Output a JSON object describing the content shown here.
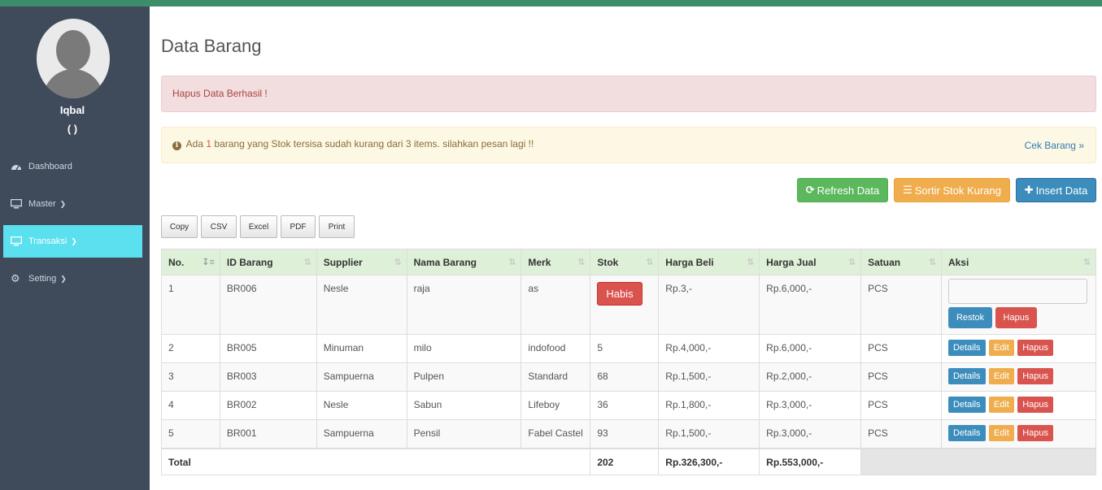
{
  "sidebar": {
    "user_name": "Iqbal",
    "user_role": "( )",
    "items": [
      {
        "label": "Dashboard",
        "icon": "dashboard-icon",
        "has_caret": false
      },
      {
        "label": "Master",
        "icon": "desktop-icon",
        "has_caret": true
      },
      {
        "label": "Transaksi",
        "icon": "desktop-icon",
        "has_caret": true,
        "active": true
      },
      {
        "label": "Setting",
        "icon": "gear-icon",
        "has_caret": true
      }
    ]
  },
  "page": {
    "title": "Data Barang",
    "alert_success": "Hapus Data Berhasil !",
    "alert_warning": {
      "prefix": "Ada",
      "count": "1",
      "suffix": "barang yang Stok tersisa sudah kurang dari 3 items. silahkan pesan lagi !!",
      "link": "Cek Barang »"
    }
  },
  "toolbar": {
    "refresh": "Refresh Data",
    "sort_low": "Sortir Stok Kurang",
    "insert": "Insert Data"
  },
  "export_buttons": [
    "Copy",
    "CSV",
    "Excel",
    "PDF",
    "Print"
  ],
  "table": {
    "headers": [
      "No.",
      "ID Barang",
      "Supplier",
      "Nama Barang",
      "Merk",
      "Stok",
      "Harga Beli",
      "Harga Jual",
      "Satuan",
      "Aksi"
    ],
    "rows": [
      {
        "no": "1",
        "id": "BR006",
        "supplier": "Nesle",
        "nama": "raja",
        "merk": "as",
        "stok": "Habis",
        "beli": "Rp.3,-",
        "jual": "Rp.6,000,-",
        "satuan": "PCS"
      },
      {
        "no": "2",
        "id": "BR005",
        "supplier": "Minuman",
        "nama": "milo",
        "merk": "indofood",
        "stok": "5",
        "beli": "Rp.4,000,-",
        "jual": "Rp.6,000,-",
        "satuan": "PCS"
      },
      {
        "no": "3",
        "id": "BR003",
        "supplier": "Sampuerna",
        "nama": "Pulpen",
        "merk": "Standard",
        "stok": "68",
        "beli": "Rp.1,500,-",
        "jual": "Rp.2,000,-",
        "satuan": "PCS"
      },
      {
        "no": "4",
        "id": "BR002",
        "supplier": "Nesle",
        "nama": "Sabun",
        "merk": "Lifeboy",
        "stok": "36",
        "beli": "Rp.1,800,-",
        "jual": "Rp.3,000,-",
        "satuan": "PCS"
      },
      {
        "no": "5",
        "id": "BR001",
        "supplier": "Sampuerna",
        "nama": "Pensil",
        "merk": "Fabel Castel",
        "stok": "93",
        "beli": "Rp.1,500,-",
        "jual": "Rp.3,000,-",
        "satuan": "PCS"
      }
    ],
    "actions": {
      "restock": "Restok",
      "delete": "Hapus",
      "details": "Details",
      "edit": "Edit"
    },
    "total": {
      "label": "Total",
      "stok": "202",
      "beli": "Rp.326,300,-",
      "jual": "Rp.553,000,-"
    }
  },
  "colors": {
    "topbar": "#3c8d6a",
    "sidebar": "#3f4a5b",
    "active_nav": "#5be0ef"
  }
}
